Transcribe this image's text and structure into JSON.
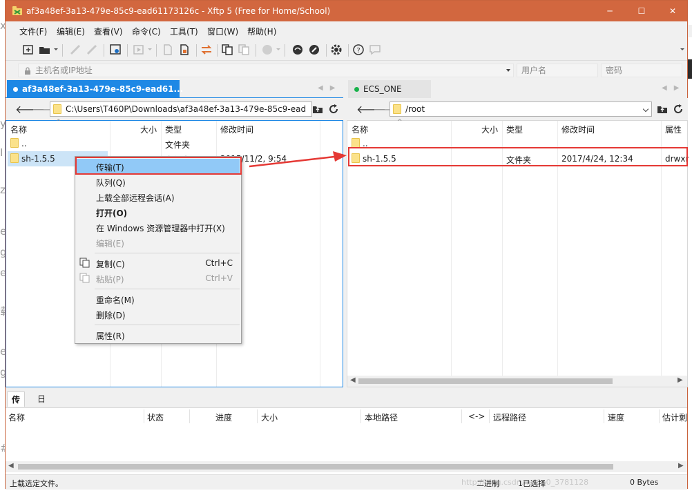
{
  "window": {
    "title": "af3a48ef-3a13-479e-85c9-ead61173126c - Xftp 5 (Free for Home/School)",
    "minimize_glyph": "─",
    "maximize_glyph": "☐",
    "close_glyph": "✕"
  },
  "menu": [
    "文件(F)",
    "编辑(E)",
    "查看(V)",
    "命令(C)",
    "工具(T)",
    "窗口(W)",
    "帮助(H)"
  ],
  "address": {
    "host_placeholder": "主机名或IP地址",
    "user_placeholder": "用户名",
    "password_placeholder": "密码"
  },
  "left_pane": {
    "tab_label": "af3a48ef-3a13-479e-85c9-ead61...",
    "path": "C:\\Users\\T460P\\Downloads\\af3a48ef-3a13-479e-85c9-ead",
    "columns": [
      "名称",
      "大小",
      "类型",
      "修改时间"
    ],
    "rows": [
      {
        "name": "..",
        "size": "",
        "type": "文件夹",
        "modified": ""
      },
      {
        "name": "sh-1.5.5",
        "size": "",
        "type": "文件夹",
        "modified": "2015/11/2, 9:54"
      }
    ]
  },
  "right_pane": {
    "tab_label": "ECS_ONE",
    "path": "/root",
    "columns": [
      "名称",
      "大小",
      "类型",
      "修改时间",
      "属性"
    ],
    "rows": [
      {
        "name": "..",
        "size": "",
        "type": "",
        "modified": "",
        "attr": ""
      },
      {
        "name": "sh-1.5.5",
        "size": "",
        "type": "文件夹",
        "modified": "2017/4/24, 12:34",
        "attr": "drwxr"
      }
    ]
  },
  "context_menu": {
    "items": [
      {
        "label": "传输(T)"
      },
      {
        "label": "队列(Q)"
      },
      {
        "label": "上载全部远程会话(A)"
      },
      {
        "label": "打开(O)"
      },
      {
        "label": "在 Windows 资源管理器中打开(X)"
      },
      {
        "label": "编辑(E)"
      },
      {
        "label": "复制(C)",
        "shortcut": "Ctrl+C"
      },
      {
        "label": "粘贴(P)",
        "shortcut": "Ctrl+V"
      },
      {
        "label": "重命名(M)"
      },
      {
        "label": "删除(D)"
      },
      {
        "label": "属性(R)"
      }
    ]
  },
  "bottom": {
    "tabs": [
      "传输",
      "日志"
    ],
    "columns": [
      "名称",
      "状态",
      "进度",
      "大小",
      "本地路径",
      "<->",
      "远程路径",
      "速度",
      "估计剩"
    ]
  },
  "status": {
    "left": "上载选定文件。",
    "mode": "二进制",
    "selected": "1已选择",
    "bytes": "0 Bytes",
    "watermark": "http://blog.csdn.net/m0_3781128"
  },
  "colors": {
    "titlebar": "#d2673f",
    "active_tab": "#1e88e5",
    "highlight": "#91c9f7",
    "annotation_red": "#e53935"
  }
}
